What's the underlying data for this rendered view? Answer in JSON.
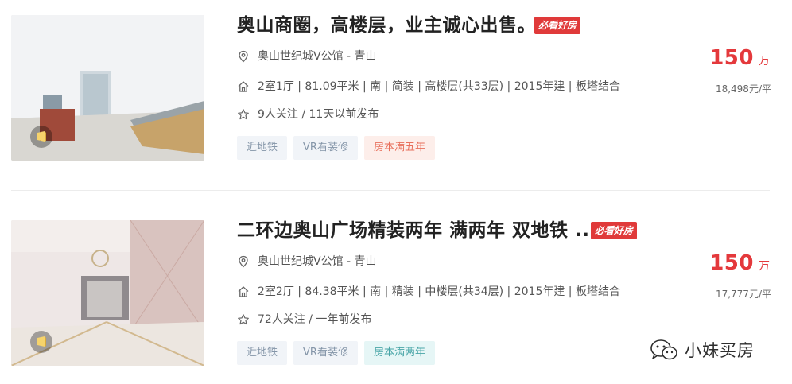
{
  "listings": [
    {
      "title": "奥山商圈，高楼层，业主诚心出售。",
      "hot_tag": "必看好房",
      "location": "奥山世纪城V公馆 - 青山",
      "house_info": "2室1厅 | 81.09平米 | 南 | 简装 | 高楼层(共33层) | 2015年建 | 板塔结合",
      "follow_info": "9人关注 / 11天以前发布",
      "tags": [
        "近地铁",
        "VR看装修",
        "房本满五年"
      ],
      "price": "150",
      "price_unit": "万",
      "unit_price": "18,498元/平"
    },
    {
      "title": "二环边奥山广场精装两年 满两年 双地铁 ...",
      "hot_tag": "必看好房",
      "location": "奥山世纪城V公馆 - 青山",
      "house_info": "2室2厅 | 84.38平米 | 南 | 精装 | 中楼层(共34层) | 2015年建 | 板塔结合",
      "follow_info": "72人关注 / 一年前发布",
      "tags": [
        "近地铁",
        "VR看装修",
        "房本满两年"
      ],
      "price": "150",
      "price_unit": "万",
      "unit_price": "17,777元/平"
    }
  ],
  "watermark": {
    "text": "小妹买房",
    "icon": "wechat-icon"
  },
  "colors": {
    "price": "#e4393c",
    "hot_tag": "#e03a3a",
    "tag_text": "#8495a8"
  }
}
